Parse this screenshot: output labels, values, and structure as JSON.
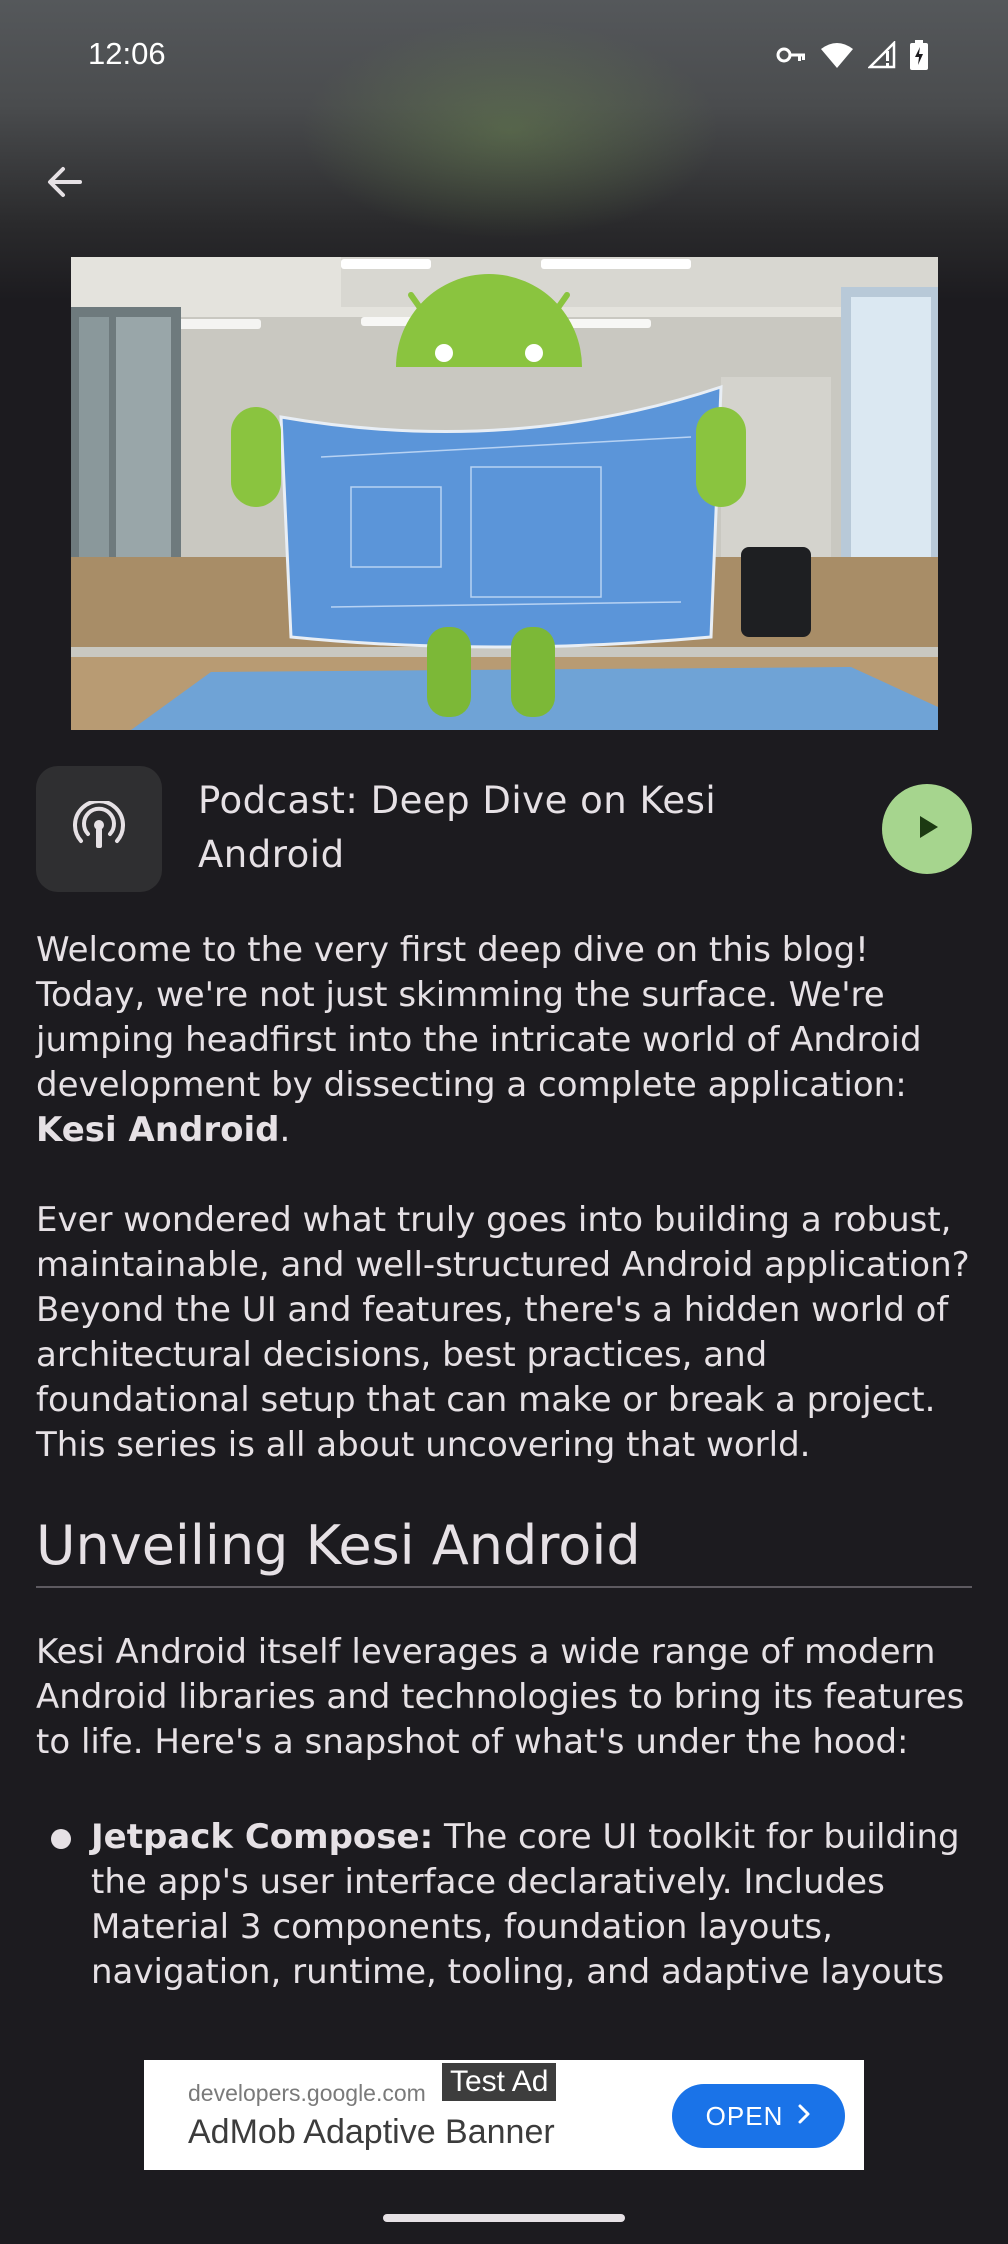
{
  "status_bar": {
    "time": "12:06",
    "icons": [
      "vpn-key-icon",
      "wifi-icon",
      "signal-icon",
      "battery-charging-icon"
    ]
  },
  "toolbar": {
    "back_icon": "arrow-back-icon"
  },
  "hero_image": {
    "description_icon": "android-robot-blueprint-image"
  },
  "podcast": {
    "icon": "podcast-icon",
    "title": "Podcast: Deep Dive on Kesi Android",
    "play_icon": "play-icon",
    "play_color": "#a6d58e"
  },
  "article": {
    "intro_part1": "Welcome to the very first deep dive on this blog! Today, we're not just skimming the surface. We're jumping headfirst into the intricate world of Android development by dissecting a complete application: ",
    "intro_bold": "Kesi Android",
    "intro_part2": ".",
    "para2": "Ever wondered what truly goes into building a robust, maintainable, and well-structured Android application? Beyond the UI and features, there's a hidden world of architectural decisions, best practices, and foundational setup that can make or break a project. This series is all about uncovering that world.",
    "section_heading": "Unveiling Kesi Android",
    "para3": "Kesi Android itself leverages a wide range of modern Android libraries and technologies to bring its features to life. Here's a snapshot of what's under the hood:",
    "list": [
      {
        "bold": "Jetpack Compose:",
        "text": " The core UI toolkit for building the app's user interface declaratively. Includes Material 3 components, foundation layouts, navigation, runtime, tooling, and adaptive layouts"
      }
    ]
  },
  "ad": {
    "tag": "Test Ad",
    "url": "developers.google.com",
    "title": "AdMob Adaptive Banner",
    "button_label": "OPEN",
    "button_color": "#1a73e8"
  }
}
